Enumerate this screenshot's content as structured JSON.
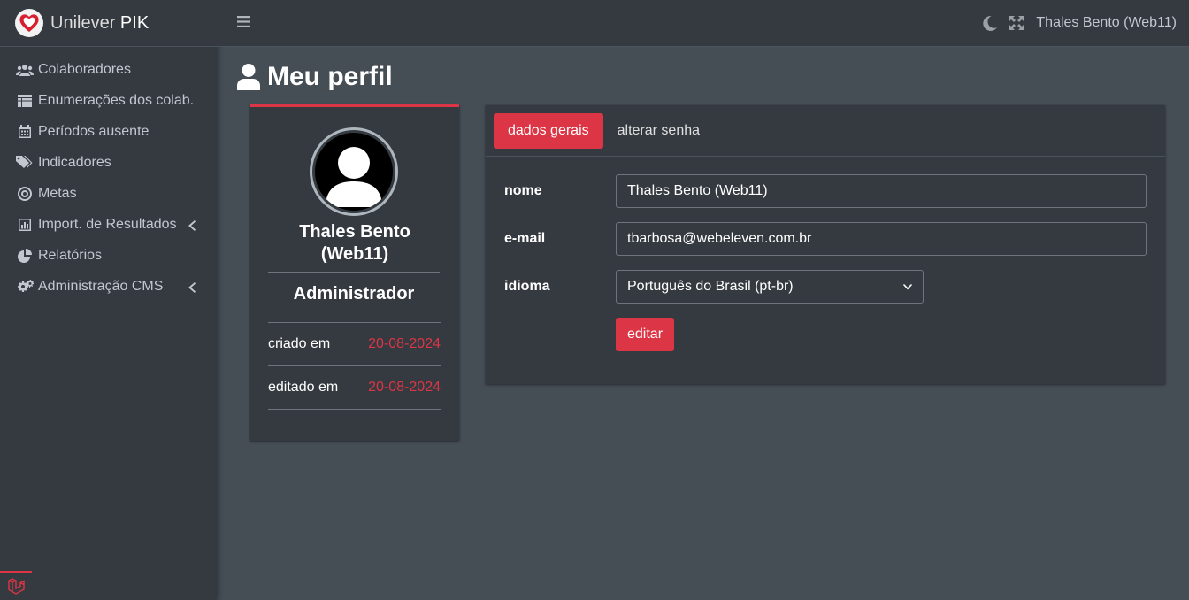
{
  "brand": {
    "name_light": "Unilever",
    "name_bold": "PIK"
  },
  "sidebar": {
    "items": [
      {
        "label": "Colaboradores",
        "icon": "users-icon"
      },
      {
        "label": "Enumerações dos colab.",
        "icon": "table-icon"
      },
      {
        "label": "Períodos ausente",
        "icon": "calendar-icon"
      },
      {
        "label": "Indicadores",
        "icon": "tags-icon"
      },
      {
        "label": "Metas",
        "icon": "bullseye-icon"
      },
      {
        "label": "Import. de Resultados",
        "icon": "chart-bar-icon",
        "has_submenu": true
      },
      {
        "label": "Relatórios",
        "icon": "chart-pie-icon"
      },
      {
        "label": "Administração CMS",
        "icon": "gears-icon",
        "has_submenu": true
      }
    ]
  },
  "header": {
    "user_name": "Thales Bento (Web11)"
  },
  "page": {
    "title": "Meu perfil"
  },
  "profile": {
    "name": "Thales Bento (Web11)",
    "role": "Administrador",
    "created_label": "criado em",
    "created_value": "20-08-2024",
    "edited_label": "editado em",
    "edited_value": "20-08-2024"
  },
  "form": {
    "tabs": [
      {
        "label": "dados gerais",
        "active": true
      },
      {
        "label": "alterar senha",
        "active": false
      }
    ],
    "name_label": "nome",
    "name_value": "Thales Bento (Web11)",
    "email_label": "e-mail",
    "email_value": "tbarbosa@webeleven.com.br",
    "language_label": "idioma",
    "language_value": "Português do Brasil (pt-br)",
    "submit_label": "editar"
  },
  "colors": {
    "accent": "#dc3545",
    "sidebar_bg": "#343a40",
    "content_bg": "#454d55"
  }
}
